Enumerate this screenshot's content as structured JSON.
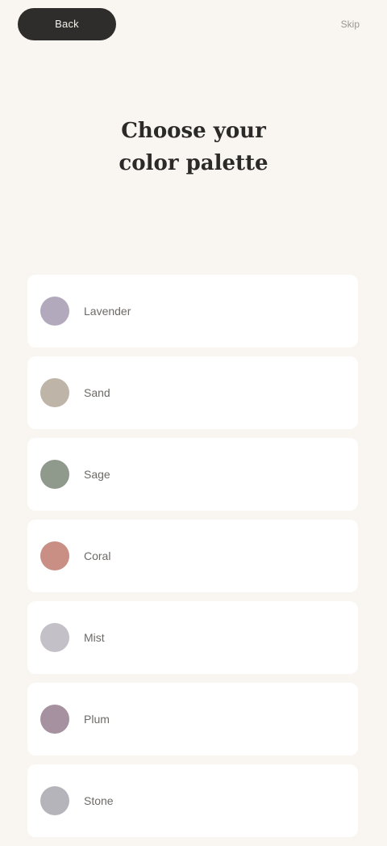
{
  "header": {
    "back_label": "Back",
    "top_link": "Skip",
    "hint": ""
  },
  "title": {
    "line1": "Choose your",
    "line2": "color palette"
  },
  "palettes": [
    {
      "label": "Lavender",
      "color": "#b3a9bc"
    },
    {
      "label": "Sand",
      "color": "#bfb4a8"
    },
    {
      "label": "Sage",
      "color": "#8f9a8d"
    },
    {
      "label": "Coral",
      "color": "#c98e84"
    },
    {
      "label": "Mist",
      "color": "#c4c0c8"
    },
    {
      "label": "Plum",
      "color": "#a5919f"
    },
    {
      "label": "Stone",
      "color": "#b5b4bb"
    }
  ]
}
